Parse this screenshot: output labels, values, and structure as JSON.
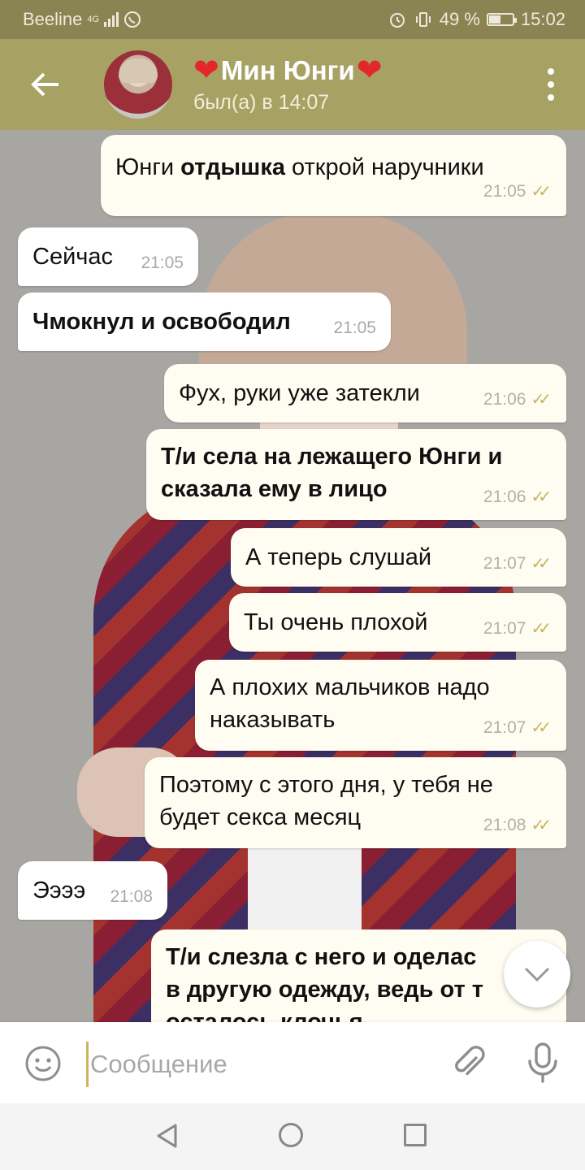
{
  "status_bar": {
    "carrier": "Beeline",
    "network": "4G",
    "battery": "49 %",
    "battery_level": 0.49,
    "time": "15:02"
  },
  "header": {
    "back_icon": "arrow-left-icon",
    "contact_name": "Мин Юнги",
    "heart_left": "❤",
    "heart_right": "❤",
    "last_seen": "был(а) в 14:07",
    "menu_icon": "more-vertical-icon"
  },
  "messages": [
    {
      "direction": "out",
      "parts": [
        {
          "text": "Юнги "
        },
        {
          "text": "отдышка",
          "bold": true
        },
        {
          "text": " открой наручники"
        }
      ],
      "time": "21:05",
      "read": true
    },
    {
      "direction": "in",
      "lines": [
        "Сейчас"
      ],
      "time": "21:05"
    },
    {
      "direction": "in",
      "lines": [
        "Чмокнул и освободил"
      ],
      "bold": true,
      "time": "21:05"
    },
    {
      "direction": "out",
      "lines": [
        "Фух, руки уже затекли"
      ],
      "time": "21:06",
      "read": true
    },
    {
      "direction": "out",
      "lines": [
        "Т/и села на лежащего Юнги и",
        "сказала ему в лицо"
      ],
      "bold": true,
      "time": "21:06",
      "read": true
    },
    {
      "direction": "out",
      "lines": [
        "А теперь слушай"
      ],
      "time": "21:07",
      "read": true
    },
    {
      "direction": "out",
      "lines": [
        "Ты очень плохой"
      ],
      "time": "21:07",
      "read": true
    },
    {
      "direction": "out",
      "lines": [
        "А плохих мальчиков надо",
        "наказывать"
      ],
      "time": "21:07",
      "read": true
    },
    {
      "direction": "out",
      "lines": [
        "Поэтому с этого дня, у тебя не",
        "будет секса месяц"
      ],
      "time": "21:08",
      "read": true
    },
    {
      "direction": "in",
      "lines": [
        "Ээээ"
      ],
      "time": "21:08"
    },
    {
      "direction": "out",
      "lines": [
        "Т/и слезла с него и оделас",
        "в другую одежду, ведь от т",
        "осталось клочья"
      ],
      "bold": true,
      "time": "",
      "read": false
    }
  ],
  "composer": {
    "emoji_icon": "smiley-icon",
    "placeholder": "Сообщение",
    "attach_icon": "paperclip-icon",
    "mic_icon": "microphone-icon"
  },
  "colors": {
    "status_bar": "#8a8452",
    "header": "#a7a164",
    "bubble_out": "#fffdf2",
    "bubble_in": "#ffffff",
    "read_ticks": "#c8b35c"
  }
}
